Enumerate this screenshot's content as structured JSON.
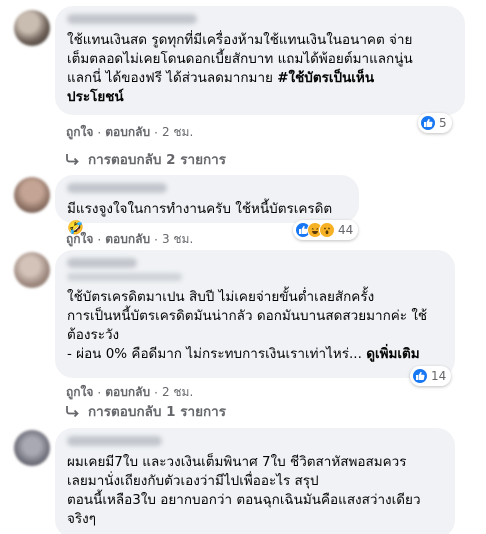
{
  "comments": [
    {
      "name": "",
      "text_lines": [
        "ใช้แทนเงินสด รูดทุกที่มีเครื่องห้ามใช้แทนเงินในอนาคต จ่าย",
        "เต็มตลอดไม่เคยโดนดอกเบี้ยสักบาท แถมได้พ้อยต์มาแลกนู่น",
        "แลกนี่ ได้ของฟรี ได้ส่วนลดมากมาย "
      ],
      "hashtag_line1": "#ใช้บัตรเป็นเห็น",
      "hashtag_line2": "ประโยชน์",
      "like_label": "ถูกใจ",
      "reply_label": "ตอบกลับ",
      "time": "2 ชม.",
      "reaction_count": "5",
      "reaction_icons": [
        "like-icon"
      ],
      "replies_label": "การตอบกลับ 2 รายการ"
    },
    {
      "name": "",
      "text_lines": [
        "มีแรงจูงใจในการทำงานครับ ใช้หนี้บัตรเครดิต🤣"
      ],
      "like_label": "ถูกใจ",
      "reply_label": "ตอบกลับ",
      "time": "3 ชม.",
      "reaction_count": "44",
      "reaction_icons": [
        "like-icon",
        "haha-icon",
        "wow-icon"
      ]
    },
    {
      "name": "",
      "text_lines": [
        "ใช้บัตรเครดิตมาเปน สิบปี ไม่เคยจ่ายขั้นต่ำเลยสักครั้ง",
        "การเป็นหนี้บัตรเครดิตมันน่ากลัว ดอกมันบานสดสวยมากค่ะ ใช้",
        "ต้องระวัง",
        "- ผ่อน 0% คือดีมาก ไม่กระทบการเงินเราเท่าไหร่... "
      ],
      "see_more": "ดูเพิ่มเติม",
      "like_label": "ถูกใจ",
      "reply_label": "ตอบกลับ",
      "time": "2 ชม.",
      "reaction_count": "14",
      "reaction_icons": [
        "like-icon"
      ],
      "replies_label": "การตอบกลับ 1 รายการ"
    },
    {
      "name": "",
      "text_lines": [
        "ผมเคยมี7ใบ และวงเงินเต็มพินาศ 7ใบ ชีวิตสาหัสพอสมควร",
        "เลยมานั่งเถียงกับตัวเองว่ามีไปเพื่ออะไร สรุป",
        "ตอนนี้เหลือ3ใบ อยากบอกว่า ตอนฉุกเฉินมันคือแสงสว่างเดียว",
        "จริงๆ"
      ]
    }
  ],
  "separator": "·",
  "colors": {
    "bubble": "#f0f2f5",
    "meta": "#65676b",
    "like_blue": "#1877f2",
    "reaction_yellow": "#f7b125"
  }
}
